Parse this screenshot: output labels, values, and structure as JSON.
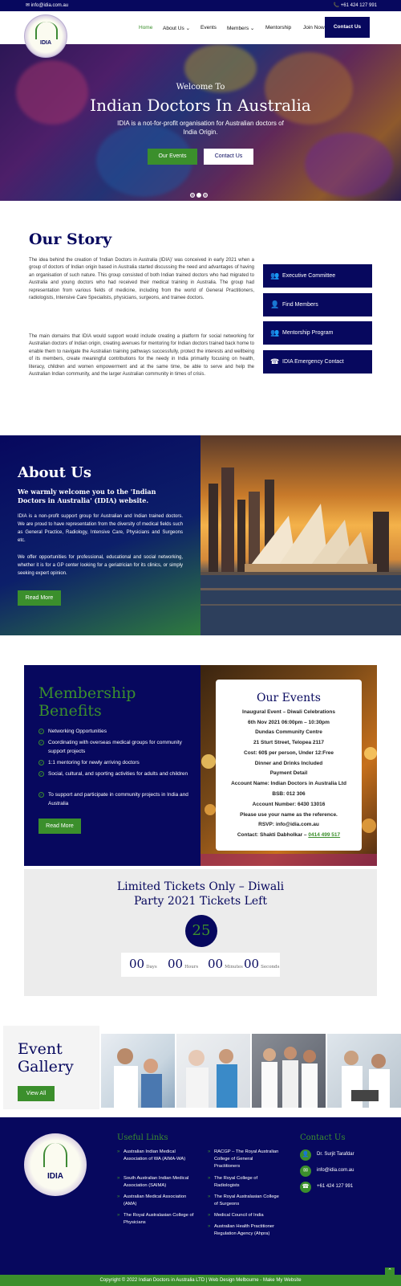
{
  "topbar": {
    "email": "✉ info@idia.com.au",
    "phone": "📞 +61 424 127 991"
  },
  "logo": {
    "text": "IDIA"
  },
  "nav": {
    "items": [
      "Home",
      "About Us",
      "Events",
      "Members",
      "Mentorship",
      "Join Now"
    ],
    "contact": "Contact Us",
    "active_color": "#3b8f2c"
  },
  "hero": {
    "welcome": "Welcome To",
    "title": "Indian Doctors In Australia",
    "subtitle": "IDIA is a not-for-profit organisation for Australian doctors of India Origin.",
    "btn_events": "Our Events",
    "btn_contact": "Contact Us"
  },
  "story": {
    "title": "Our Story",
    "p1": "The idea behind the creation of 'Indian Doctors in Australia (IDIA)' was conceived in early 2021 when a group of doctors of Indian origin based in Australia started discussing the need and advantages of having an organisation of such nature. This group consisted of both Indian trained doctors who had migrated to Australia and young doctors who had received their medical training in Australia. The group had representation from various fields of medicine, including from the world of General Practitioners, radiologists, Intensive Care Specialists, physicians, surgeons, and trainee doctors.",
    "p2": "The main domains that IDIA would support would include creating a platform for social networking for Australian doctors of Indian origin, creating avenues for mentoring for Indian doctors trained back home to enable them to navigate the Australian training pathways successfully, protect the interests and wellbeing of its members, create meaningful contributions for the needy in India primarily focusing on health, literacy, children and women empowerment and at the same time, be able to serve and help the Australian Indian community, and the larger Australian community in times of crisis.",
    "side_buttons": [
      "Executive Committee",
      "Find Members",
      "Mentorship Program",
      "IDIA Emergency Contact"
    ]
  },
  "about": {
    "title": "About Us",
    "heading": "We warmly welcome you to the 'Indian Doctors in Australia' (IDIA) website.",
    "p1": "IDIA is a non-profit support group for Australian and Indian trained doctors. We are proud to have representation from the diversity of medical fields such as General Practice, Radiology, Intensive Care, Physicians and Surgeons etc.",
    "p2": "We offer opportunities for professional, educational and social networking, whether it is for a GP center looking for a geriatrician for its clinics, or simply seeking expert opinion.",
    "btn": "Read More"
  },
  "membership": {
    "title": "Membership Benefits",
    "items": [
      "Networking Opportunities",
      "Coordinating with overseas medical groups for community support projects",
      "1:1 mentoring for newly arriving doctors",
      "Social, cultural, and sporting activities for adults and children",
      "To support and participate in community projects in India and Australia"
    ],
    "btn": "Read More"
  },
  "events": {
    "title": "Our Events",
    "lines": [
      "Inaugural Event  – Diwali Celebrations",
      "6th Nov 2021 06:00pm – 10:30pm",
      "Dundas Community Centre",
      "21 Sturt Street, Telopea 2117",
      "Cost: 60$ per person, Under 12:Free",
      "Dinner and Drinks Included",
      "Payment Detail",
      "Account Name: Indian Doctors in Australia Ltd",
      "BSB: 012 306",
      "Account Number: 6430 13016",
      "Please use your name as the reference.",
      "RSVP: info@idia.com.au"
    ],
    "contact_prefix": "Contact: Shakti Dabholkar – ",
    "contact_phone": "0414 499 517"
  },
  "tickets": {
    "title": "Limited Tickets Only – Diwali Party 2021 Tickets Left",
    "count": "25",
    "countdown": [
      {
        "value": "00",
        "unit": "Days"
      },
      {
        "value": "00",
        "unit": "Hours"
      },
      {
        "value": "00",
        "unit": "Minutes"
      },
      {
        "value": "00",
        "unit": "Seconds"
      }
    ]
  },
  "gallery": {
    "title": "Event Gallery",
    "btn": "View All"
  },
  "footer": {
    "useful_links_title": "Useful Links",
    "links_col1": [
      "Australian Indian Medical Association of WA (AIMA-WA)",
      "South Australian Indian Medical Association (SAIMA)",
      "Australian Medical Association (AMA)",
      "The Royal Australasian College of Physicians"
    ],
    "links_col2": [
      "RACGP – The Royal Australian College of General Practitioners",
      "The Royal College of Radiologists",
      "The Royal Australasian College of Surgeons",
      "Medical Council of India",
      "Australian Health Practitioner Regulation Agency (Ahpra)"
    ],
    "contact_title": "Contact Us",
    "contacts": [
      "Dr. Surjit Tarafdar",
      "info@idia.com.au",
      "+61 424 127 991"
    ],
    "copyright": "Copyright © 2022 Indian Doctors in Australia LTD | Web Design Melbourne - Make My Website"
  }
}
